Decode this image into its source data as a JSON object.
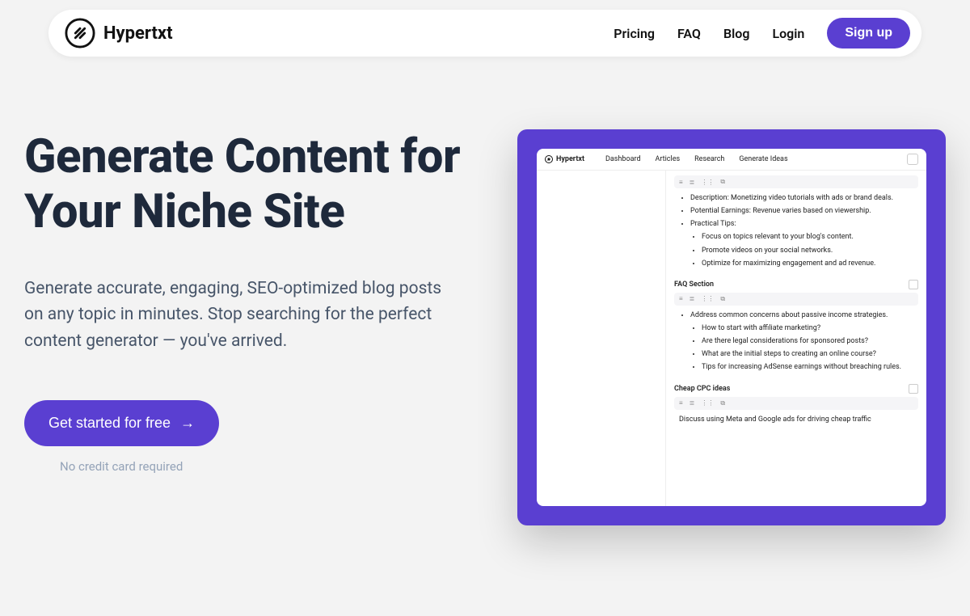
{
  "brand": "Hypertxt",
  "nav": {
    "links": [
      "Pricing",
      "FAQ",
      "Blog",
      "Login"
    ],
    "signup": "Sign up"
  },
  "hero": {
    "title": "Generate Content for Your Niche Site",
    "subtitle": "Generate accurate, engaging, SEO-optimized blog posts on any topic in minutes. Stop searching for the perfect content generator — you've arrived.",
    "cta": "Get started for free",
    "no_cc": "No credit card required"
  },
  "app": {
    "brand": "Hypertxt",
    "tabs": [
      "Dashboard",
      "Articles",
      "Research",
      "Generate Ideas"
    ],
    "sections": [
      {
        "bullets": [
          "Description: Monetizing video tutorials with ads or brand deals.",
          "Potential Earnings: Revenue varies based on viewership.",
          {
            "text": "Practical Tips:",
            "children": [
              "Focus on topics relevant to your blog's content.",
              "Promote videos on your social networks.",
              "Optimize for maximizing engagement and ad revenue."
            ]
          }
        ]
      },
      {
        "heading": "FAQ Section",
        "bullets": [
          {
            "text": "Address common concerns about passive income strategies.",
            "children": [
              "How to start with affiliate marketing?",
              "Are there legal considerations for sponsored posts?",
              "What are the initial steps to creating an online course?",
              "Tips for increasing AdSense earnings without breaching rules."
            ]
          }
        ]
      },
      {
        "heading": "Cheap CPC ideas",
        "body": "Discuss using Meta and Google ads for driving cheap traffic"
      }
    ]
  }
}
